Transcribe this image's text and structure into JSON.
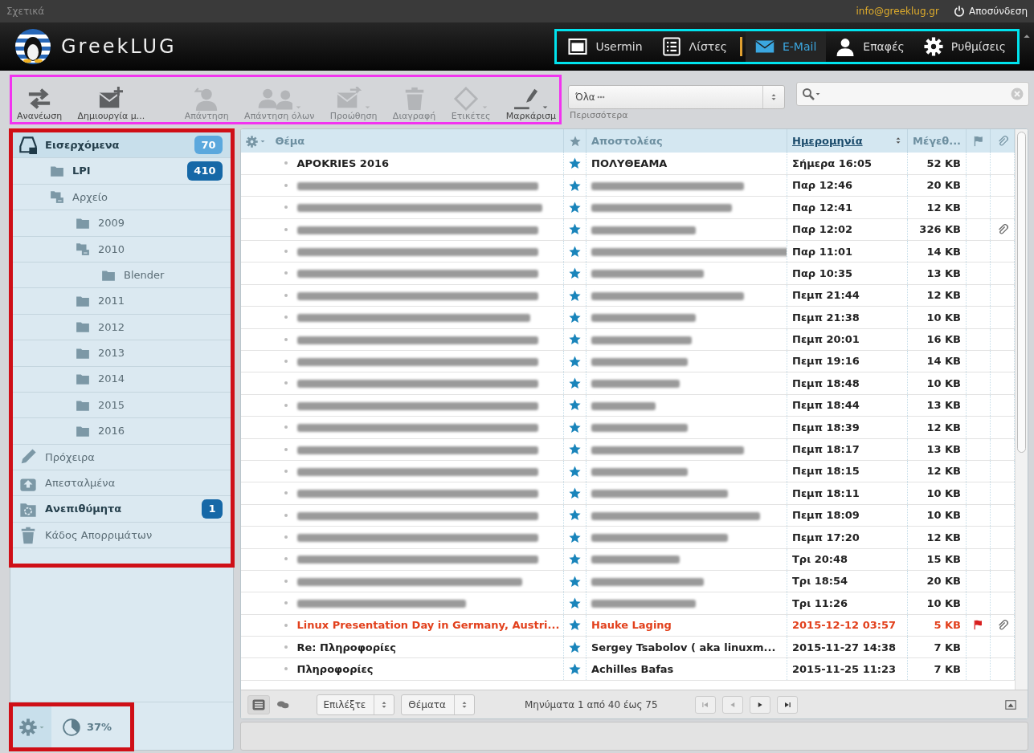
{
  "top_bar": {
    "about": "Σχετικά",
    "account": "info@greeklug.gr",
    "logout": "Αποσύνδεση"
  },
  "header": {
    "logo_text": "GreekLUG",
    "nav": [
      {
        "label": "Usermin",
        "kind": "usermin",
        "selected": false,
        "separator_after": false
      },
      {
        "label": "Λίστες",
        "kind": "lists",
        "selected": false,
        "separator_after": true
      },
      {
        "label": "E-Mail",
        "kind": "mail",
        "selected": true,
        "separator_after": false
      },
      {
        "label": "Επαφές",
        "kind": "contacts",
        "selected": false,
        "separator_after": false
      },
      {
        "label": "Ρυθμίσεις",
        "kind": "settings",
        "selected": false,
        "separator_after": false
      }
    ]
  },
  "toolbar": {
    "buttons": [
      {
        "label": "Ανανέωση",
        "kind": "refresh",
        "disabled": false,
        "menu": false
      },
      {
        "label": "Δημιουργία μ...",
        "kind": "compose",
        "disabled": false,
        "menu": false
      },
      {
        "label": "Απάντηση",
        "kind": "reply",
        "disabled": true,
        "menu": false
      },
      {
        "label": "Απάντηση όλων",
        "kind": "reply-all",
        "disabled": true,
        "menu": true
      },
      {
        "label": "Προώθηση",
        "kind": "forward",
        "disabled": true,
        "menu": true
      },
      {
        "label": "Διαγραφή",
        "kind": "delete",
        "disabled": true,
        "menu": false
      },
      {
        "label": "Ετικέτες",
        "kind": "tags",
        "disabled": true,
        "menu": true
      },
      {
        "label": "Μαρκάρισμ",
        "kind": "mark",
        "disabled": false,
        "menu": true
      }
    ],
    "filter": {
      "value": "Όλα",
      "label": "Περισσότερα"
    }
  },
  "folders": [
    {
      "label": "Εισερχόμενα",
      "kind": "inbox",
      "selected": true,
      "unread": "70",
      "children": [
        {
          "label": "LPI",
          "kind": "folder",
          "selected": false,
          "unread": "410"
        },
        {
          "label": "Αρχείο",
          "kind": "folders",
          "selected": false,
          "children": [
            {
              "label": "2009",
              "kind": "folder",
              "selected": false
            },
            {
              "label": "2010",
              "kind": "folders",
              "selected": false,
              "children": [
                {
                  "label": "Blender",
                  "kind": "folder",
                  "selected": false
                }
              ]
            },
            {
              "label": "2011",
              "kind": "folder",
              "selected": false
            },
            {
              "label": "2012",
              "kind": "folder",
              "selected": false
            },
            {
              "label": "2013",
              "kind": "folder",
              "selected": false
            },
            {
              "label": "2014",
              "kind": "folder",
              "selected": false
            },
            {
              "label": "2015",
              "kind": "folder",
              "selected": false
            },
            {
              "label": "2016",
              "kind": "folder",
              "selected": false
            }
          ]
        }
      ]
    },
    {
      "label": "Πρόχειρα",
      "kind": "drafts",
      "selected": false
    },
    {
      "label": "Απεσταλμένα",
      "kind": "sent",
      "selected": false
    },
    {
      "label": "Ανεπιθύμητα",
      "kind": "junk",
      "selected": false,
      "unread": "1"
    },
    {
      "label": "Κάδος Απορριμάτων",
      "kind": "trash",
      "selected": false
    }
  ],
  "quota": {
    "reading": "37%",
    "level": 0.37
  },
  "message_list": {
    "columns": [
      {
        "label": "Θέμα",
        "kind": "subject",
        "sorted": false
      },
      {
        "kind": "star"
      },
      {
        "label": "Αποστολέας",
        "kind": "sender",
        "sorted": false
      },
      {
        "label": "Ημερομηνία",
        "kind": "date",
        "sorted": true
      },
      {
        "label": "Μέγεθ...",
        "kind": "size",
        "sorted": false
      },
      {
        "kind": "flag"
      },
      {
        "kind": "attachment"
      }
    ],
    "rows": [
      {
        "kind": "message",
        "subject": "APOKRIES 2016",
        "sender": "ΠΟΛΥΘΕΑΜΑ",
        "date": "Σήμερα 16:05",
        "size": "52 KB",
        "flagged": false,
        "attachment": false
      },
      {
        "kind": "redacted",
        "date": "Παρ 12:46",
        "size": "20 KB",
        "flagged": false,
        "attachment": false
      },
      {
        "kind": "redacted",
        "date": "Παρ 12:41",
        "size": "12 KB",
        "flagged": false,
        "attachment": false
      },
      {
        "kind": "redacted",
        "date": "Παρ 12:02",
        "size": "326 KB",
        "flagged": false,
        "attachment": true
      },
      {
        "kind": "redacted",
        "date": "Παρ 11:01",
        "size": "14 KB",
        "flagged": false,
        "attachment": false
      },
      {
        "kind": "redacted",
        "date": "Παρ 10:35",
        "size": "13 KB",
        "flagged": false,
        "attachment": false
      },
      {
        "kind": "redacted",
        "date": "Πεμπ 21:44",
        "size": "12 KB",
        "flagged": false,
        "attachment": false
      },
      {
        "kind": "redacted",
        "date": "Πεμπ 21:38",
        "size": "10 KB",
        "flagged": false,
        "attachment": false
      },
      {
        "kind": "redacted",
        "date": "Πεμπ 20:01",
        "size": "16 KB",
        "flagged": false,
        "attachment": false
      },
      {
        "kind": "redacted",
        "date": "Πεμπ 19:16",
        "size": "14 KB",
        "flagged": false,
        "attachment": false
      },
      {
        "kind": "redacted",
        "date": "Πεμπ 18:48",
        "size": "10 KB",
        "flagged": false,
        "attachment": false
      },
      {
        "kind": "redacted",
        "date": "Πεμπ 18:44",
        "size": "13 KB",
        "flagged": false,
        "attachment": false
      },
      {
        "kind": "redacted",
        "date": "Πεμπ 18:39",
        "size": "12 KB",
        "flagged": false,
        "attachment": false
      },
      {
        "kind": "redacted",
        "date": "Πεμπ 18:17",
        "size": "13 KB",
        "flagged": false,
        "attachment": false
      },
      {
        "kind": "redacted",
        "date": "Πεμπ 18:15",
        "size": "12 KB",
        "flagged": false,
        "attachment": false
      },
      {
        "kind": "redacted",
        "date": "Πεμπ 18:11",
        "size": "10 KB",
        "flagged": false,
        "attachment": false
      },
      {
        "kind": "redacted",
        "date": "Πεμπ 18:09",
        "size": "10 KB",
        "flagged": false,
        "attachment": false
      },
      {
        "kind": "redacted",
        "date": "Πεμπ 17:20",
        "size": "12 KB",
        "flagged": false,
        "attachment": false
      },
      {
        "kind": "redacted",
        "date": "Τρι 20:48",
        "size": "15 KB",
        "flagged": false,
        "attachment": false
      },
      {
        "kind": "redacted",
        "date": "Τρι 18:54",
        "size": "20 KB",
        "flagged": false,
        "attachment": false
      },
      {
        "kind": "redacted",
        "date": "Τρι 11:26",
        "size": "10 KB",
        "flagged": false,
        "attachment": false
      },
      {
        "kind": "message",
        "subject": "Linux Presentation Day in Germany, Austri...",
        "sender": "Hauke Laging",
        "date": "2015-12-12 03:57",
        "size": "5 KB",
        "flagged": true,
        "attachment": true
      },
      {
        "kind": "message",
        "subject": "Re: Πληροφορίες",
        "sender": "Sergey Tsabolov ( aka linuxm...",
        "date": "2015-11-27 14:38",
        "size": "7 KB",
        "flagged": false,
        "attachment": false
      },
      {
        "kind": "message",
        "subject": "Πληροφορίες",
        "sender": "Achilles Bafas",
        "date": "2015-11-25 11:23",
        "size": "7 KB",
        "flagged": false,
        "attachment": false
      }
    ],
    "footer": {
      "select": "Επιλέξτε",
      "threads": "Θέματα",
      "count": "Μηνύματα 1 από 40 έως 75"
    }
  }
}
